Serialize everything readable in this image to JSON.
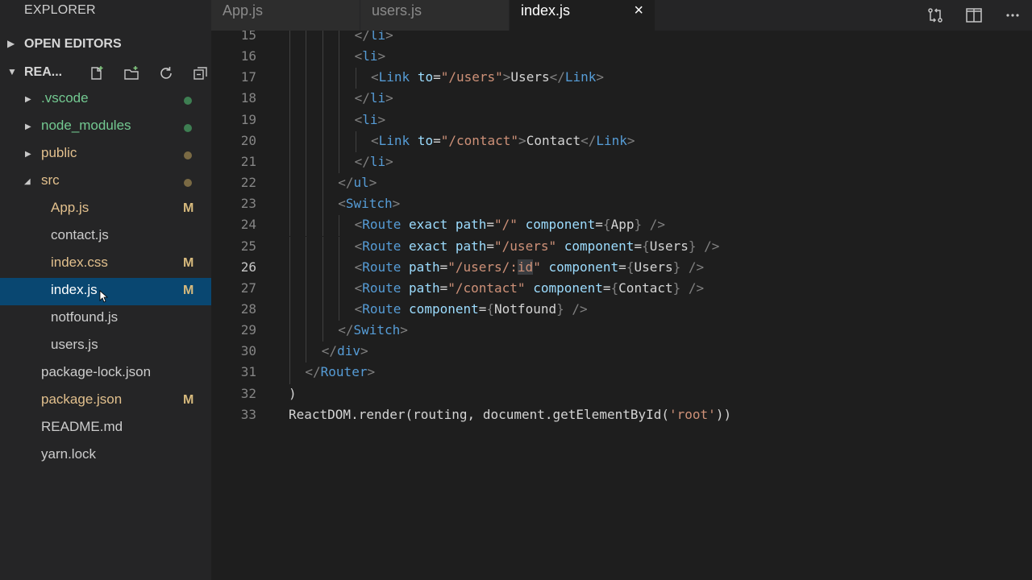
{
  "sidebar": {
    "title": "EXPLORER",
    "open_editors": "OPEN EDITORS",
    "project": "REA...",
    "tree": [
      {
        "name": ".vscode",
        "kind": "folder",
        "open": false,
        "color": "green",
        "dot": "#3e7e52"
      },
      {
        "name": "node_modules",
        "kind": "folder",
        "open": false,
        "color": "green",
        "dot": "#3e7e52"
      },
      {
        "name": "public",
        "kind": "folder",
        "open": false,
        "color": "yellow",
        "dot": "#7a6a44"
      },
      {
        "name": "src",
        "kind": "folder",
        "open": true,
        "color": "yellow",
        "dot": "#7a6a44"
      },
      {
        "name": "App.js",
        "kind": "file",
        "color": "yellow",
        "badge": "M"
      },
      {
        "name": "contact.js",
        "kind": "file",
        "color": "default"
      },
      {
        "name": "index.css",
        "kind": "file",
        "color": "yellow",
        "badge": "M"
      },
      {
        "name": "index.js",
        "kind": "file",
        "color": "white",
        "badge": "M",
        "selected": true
      },
      {
        "name": "notfound.js",
        "kind": "file",
        "color": "default"
      },
      {
        "name": "users.js",
        "kind": "file",
        "color": "default"
      },
      {
        "name": "package-lock.json",
        "kind": "file",
        "color": "default"
      },
      {
        "name": "package.json",
        "kind": "file",
        "color": "yellow",
        "badge": "M"
      },
      {
        "name": "README.md",
        "kind": "file",
        "color": "default"
      },
      {
        "name": "yarn.lock",
        "kind": "file",
        "color": "default"
      }
    ]
  },
  "tabs": [
    {
      "label": "App.js",
      "active": false
    },
    {
      "label": "users.js",
      "active": false
    },
    {
      "label": "index.js",
      "active": true
    }
  ],
  "tab_close": "×",
  "editor": {
    "current_line": 26,
    "lines": [
      {
        "n": "15",
        "indent": 4,
        "t": [
          [
            "pu",
            "</"
          ],
          [
            "tg",
            "li"
          ],
          [
            "pu",
            ">"
          ]
        ]
      },
      {
        "n": "16",
        "indent": 4,
        "t": [
          [
            "pu",
            "<"
          ],
          [
            "tg",
            "li"
          ],
          [
            "pu",
            ">"
          ]
        ]
      },
      {
        "n": "17",
        "indent": 5,
        "t": [
          [
            "pu",
            "<"
          ],
          [
            "tg",
            "Link"
          ],
          [
            "tx",
            " "
          ],
          [
            "at",
            "to"
          ],
          [
            "tx",
            "="
          ],
          [
            "st",
            "\"/users\""
          ],
          [
            "pu",
            ">"
          ],
          [
            "tx",
            "Users"
          ],
          [
            "pu",
            "</"
          ],
          [
            "tg",
            "Link"
          ],
          [
            "pu",
            ">"
          ]
        ]
      },
      {
        "n": "18",
        "indent": 4,
        "t": [
          [
            "pu",
            "</"
          ],
          [
            "tg",
            "li"
          ],
          [
            "pu",
            ">"
          ]
        ]
      },
      {
        "n": "19",
        "indent": 4,
        "t": [
          [
            "pu",
            "<"
          ],
          [
            "tg",
            "li"
          ],
          [
            "pu",
            ">"
          ]
        ]
      },
      {
        "n": "20",
        "indent": 5,
        "t": [
          [
            "pu",
            "<"
          ],
          [
            "tg",
            "Link"
          ],
          [
            "tx",
            " "
          ],
          [
            "at",
            "to"
          ],
          [
            "tx",
            "="
          ],
          [
            "st",
            "\"/contact\""
          ],
          [
            "pu",
            ">"
          ],
          [
            "tx",
            "Contact"
          ],
          [
            "pu",
            "</"
          ],
          [
            "tg",
            "Link"
          ],
          [
            "pu",
            ">"
          ]
        ]
      },
      {
        "n": "21",
        "indent": 4,
        "t": [
          [
            "pu",
            "</"
          ],
          [
            "tg",
            "li"
          ],
          [
            "pu",
            ">"
          ]
        ]
      },
      {
        "n": "22",
        "indent": 3,
        "t": [
          [
            "pu",
            "</"
          ],
          [
            "tg",
            "ul"
          ],
          [
            "pu",
            ">"
          ]
        ]
      },
      {
        "n": "23",
        "indent": 3,
        "t": [
          [
            "pu",
            "<"
          ],
          [
            "tg",
            "Switch"
          ],
          [
            "pu",
            ">"
          ]
        ]
      },
      {
        "n": "24",
        "indent": 4,
        "t": [
          [
            "pu",
            "<"
          ],
          [
            "tg",
            "Route"
          ],
          [
            "tx",
            " "
          ],
          [
            "at",
            "exact"
          ],
          [
            "tx",
            " "
          ],
          [
            "at",
            "path"
          ],
          [
            "tx",
            "="
          ],
          [
            "st",
            "\"/\""
          ],
          [
            "tx",
            " "
          ],
          [
            "at",
            "component"
          ],
          [
            "tx",
            "="
          ],
          [
            "pu",
            "{"
          ],
          [
            "tx",
            "App"
          ],
          [
            "pu",
            "}"
          ],
          [
            "tx",
            " "
          ],
          [
            "pu",
            "/>"
          ]
        ]
      },
      {
        "n": "25",
        "indent": 4,
        "t": [
          [
            "pu",
            "<"
          ],
          [
            "tg",
            "Route"
          ],
          [
            "tx",
            " "
          ],
          [
            "at",
            "exact"
          ],
          [
            "tx",
            " "
          ],
          [
            "at",
            "path"
          ],
          [
            "tx",
            "="
          ],
          [
            "st",
            "\"/users\""
          ],
          [
            "tx",
            " "
          ],
          [
            "at",
            "component"
          ],
          [
            "tx",
            "="
          ],
          [
            "pu",
            "{"
          ],
          [
            "tx",
            "Users"
          ],
          [
            "pu",
            "}"
          ],
          [
            "tx",
            " "
          ],
          [
            "pu",
            "/>"
          ]
        ]
      },
      {
        "n": "26",
        "indent": 4,
        "t": [
          [
            "pu",
            "<"
          ],
          [
            "tg",
            "Route"
          ],
          [
            "tx",
            " "
          ],
          [
            "at",
            "path"
          ],
          [
            "tx",
            "="
          ],
          [
            "st",
            "\"/users/:"
          ],
          [
            "sth",
            "id"
          ],
          [
            "st",
            "\""
          ],
          [
            "tx",
            " "
          ],
          [
            "at",
            "component"
          ],
          [
            "tx",
            "="
          ],
          [
            "pu",
            "{"
          ],
          [
            "tx",
            "Users"
          ],
          [
            "pu",
            "}"
          ],
          [
            "tx",
            " "
          ],
          [
            "pu",
            "/>"
          ]
        ]
      },
      {
        "n": "27",
        "indent": 4,
        "t": [
          [
            "pu",
            "<"
          ],
          [
            "tg",
            "Route"
          ],
          [
            "tx",
            " "
          ],
          [
            "at",
            "path"
          ],
          [
            "tx",
            "="
          ],
          [
            "st",
            "\"/contact\""
          ],
          [
            "tx",
            " "
          ],
          [
            "at",
            "component"
          ],
          [
            "tx",
            "="
          ],
          [
            "pu",
            "{"
          ],
          [
            "tx",
            "Contact"
          ],
          [
            "pu",
            "}"
          ],
          [
            "tx",
            " "
          ],
          [
            "pu",
            "/>"
          ]
        ]
      },
      {
        "n": "28",
        "indent": 4,
        "t": [
          [
            "pu",
            "<"
          ],
          [
            "tg",
            "Route"
          ],
          [
            "tx",
            " "
          ],
          [
            "at",
            "component"
          ],
          [
            "tx",
            "="
          ],
          [
            "pu",
            "{"
          ],
          [
            "tx",
            "Notfound"
          ],
          [
            "pu",
            "}"
          ],
          [
            "tx",
            " "
          ],
          [
            "pu",
            "/>"
          ]
        ]
      },
      {
        "n": "29",
        "indent": 3,
        "t": [
          [
            "pu",
            "</"
          ],
          [
            "tg",
            "Switch"
          ],
          [
            "pu",
            ">"
          ]
        ]
      },
      {
        "n": "30",
        "indent": 2,
        "t": [
          [
            "pu",
            "</"
          ],
          [
            "tg",
            "div"
          ],
          [
            "pu",
            ">"
          ]
        ]
      },
      {
        "n": "31",
        "indent": 1,
        "t": [
          [
            "pu",
            "</"
          ],
          [
            "tg",
            "Router"
          ],
          [
            "pu",
            ">"
          ]
        ]
      },
      {
        "n": "32",
        "indent": 0,
        "t": [
          [
            "tx",
            ")"
          ]
        ]
      },
      {
        "n": "33",
        "indent": 0,
        "t": [
          [
            "tx",
            "ReactDOM.render(routing, document.getElementById("
          ],
          [
            "st",
            "'root'"
          ],
          [
            "tx",
            "))"
          ]
        ]
      }
    ]
  }
}
